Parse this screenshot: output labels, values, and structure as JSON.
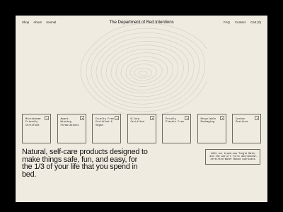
{
  "nav": {
    "left": [
      "Shop",
      "About",
      "Journal"
    ],
    "title": "The Department of Bed Intentions",
    "right": [
      "FAQ",
      "Contact",
      "Cart (0)"
    ]
  },
  "features": [
    "Microbiome Friendly Certified",
    "Award-Winning Formulations",
    "Cruelty Free Certified & Vegan",
    "B-Corp Certified",
    "Proudly Plastic Free",
    "Recyclable Packaging",
    "Carbon Positive"
  ],
  "hero": {
    "headline": "Natural, self-care products designed to make things safe, fun, and easy, for the 1/3 of your life that you spend in bed."
  },
  "note": {
    "text": "With our brand-new Tingle Balm, and the world's first microbiome-certified Water Based Lubricant."
  },
  "colors": {
    "page_background": "#efebe0",
    "frame": "#000000",
    "text": "#111111",
    "border": "#6d6a62",
    "topo_lines": "#cfcac0"
  }
}
